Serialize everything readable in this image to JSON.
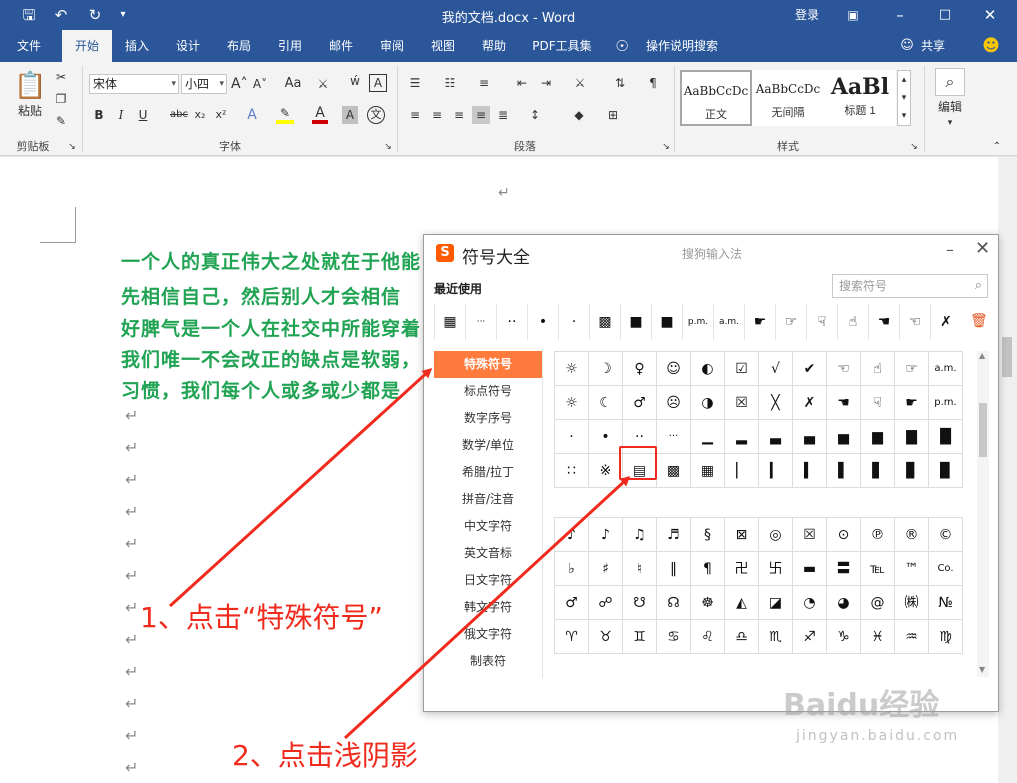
{
  "titlebar": {
    "doc_title": "我的文档.docx - Word",
    "login": "登录",
    "quick_access_icons": [
      "save-icon",
      "undo-icon",
      "redo-icon",
      "customize-icon"
    ],
    "window_controls": [
      "ribbon-display-icon",
      "minimize-icon",
      "maximize-icon",
      "close-icon"
    ]
  },
  "menubar": {
    "tabs": [
      "文件",
      "开始",
      "插入",
      "设计",
      "布局",
      "引用",
      "邮件",
      "审阅",
      "视图",
      "帮助",
      "PDF工具集",
      "操作说明搜索"
    ],
    "active_tab": "开始",
    "share": "共享"
  },
  "ribbon": {
    "clipboard": {
      "paste": "粘贴",
      "label": "剪贴板"
    },
    "font": {
      "font_name": "宋体",
      "font_size": "小四",
      "label": "字体",
      "buttons": [
        "B",
        "I",
        "U",
        "abc",
        "x₂",
        "x²",
        "A",
        "A",
        "A",
        "Aa",
        "A",
        "文",
        "A"
      ]
    },
    "paragraph": {
      "label": "段落"
    },
    "styles": {
      "label": "样式",
      "items": [
        {
          "sample": "AaBbCcDc",
          "name": "正文"
        },
        {
          "sample": "AaBbCcDc",
          "name": "无间隔"
        },
        {
          "sample": "AaBl",
          "name": "标题 1"
        }
      ]
    },
    "editing": {
      "label": "编辑"
    }
  },
  "document": {
    "lines": [
      "一个人的真正伟大之处就在于他能",
      "先相信自己，然后别人才会相信",
      "好脾气是一个人在社交中所能穿着",
      "我们唯一不会改正的缺点是软弱，",
      "习惯，我们每个人或多或少都是"
    ],
    "return_mark": "↵"
  },
  "dialog": {
    "title": "符号大全",
    "logo": "S",
    "ime": "搜狗输入法",
    "recent_label": "最近使用",
    "search_placeholder": "搜索符号",
    "recent_symbols": [
      "▦",
      "···",
      "··",
      "•",
      "·",
      "▩",
      "■",
      "■",
      "p.m.",
      "a.m.",
      "☛",
      "☞",
      "☟",
      "☝",
      "☚",
      "☜",
      "✗"
    ],
    "categories": [
      "特殊符号",
      "标点符号",
      "数字序号",
      "数学/单位",
      "希腊/拉丁",
      "拼音/注音",
      "中文字符",
      "英文音标",
      "日文字符",
      "韩文字符",
      "俄文字符",
      "制表符"
    ],
    "active_category": "特殊符号",
    "grid_top": [
      [
        "☼",
        "☽",
        "♀",
        "☺",
        "◐",
        "☑",
        "√",
        "✔",
        "☜",
        "☝",
        "☞",
        "a.m."
      ],
      [
        "☼",
        "☾",
        "♂",
        "☹",
        "◑",
        "☒",
        "╳",
        "✗",
        "☚",
        "☟",
        "☛",
        "p.m."
      ],
      [
        "·",
        "•",
        "··",
        "···",
        "▁",
        "▂",
        "▃",
        "▄",
        "▅",
        "▆",
        "▇",
        "█"
      ],
      [
        "∷",
        "※",
        "▤",
        "▩",
        "▦",
        "▏",
        "▎",
        "▍",
        "▌",
        "▋",
        "▊",
        "▉"
      ]
    ],
    "grid_bottom": [
      [
        "♪",
        "♪",
        "♫",
        "♬",
        "§",
        "⊠",
        "◎",
        "☒",
        "⊙",
        "℗",
        "®",
        "©"
      ],
      [
        "♭",
        "♯",
        "♮",
        "‖",
        "¶",
        "卍",
        "卐",
        "▬",
        "〓",
        "℡",
        "™",
        "Co."
      ],
      [
        "♂",
        "☍",
        "☋",
        "☊",
        "☸",
        "◭",
        "◪",
        "◔",
        "◕",
        "@",
        "㈱",
        "№"
      ],
      [
        "♈",
        "♉",
        "♊",
        "♋",
        "♌",
        "♎",
        "♏",
        "♐",
        "♑",
        "♓",
        "♒",
        "♍"
      ]
    ]
  },
  "annotations": {
    "step1": "1、点击“特殊符号”",
    "step2": "2、点击浅阴影"
  },
  "watermark": {
    "brand": "Baidu经验",
    "url": "jingyan.baidu.com"
  }
}
